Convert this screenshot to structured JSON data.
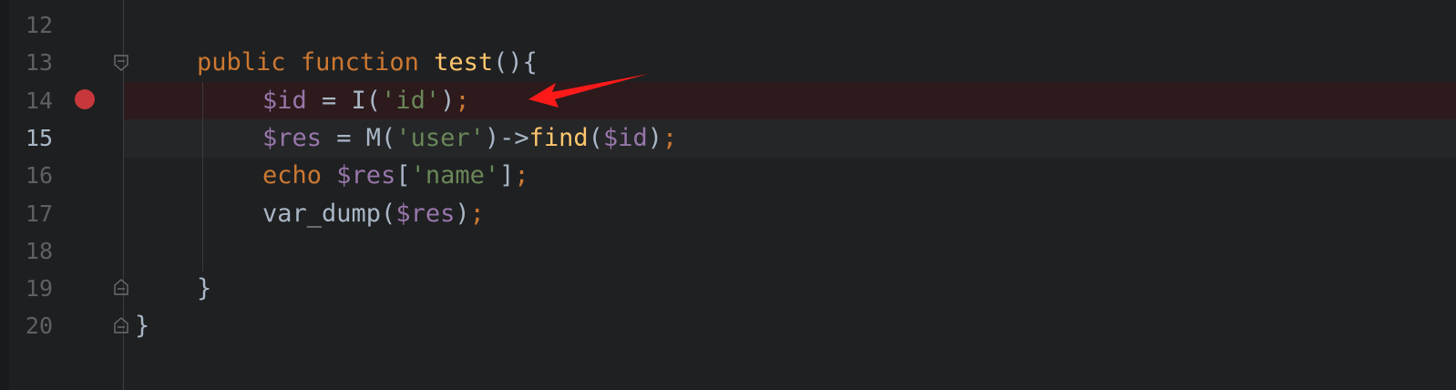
{
  "editor": {
    "lines": [
      {
        "number": "12",
        "tokens": []
      },
      {
        "number": "13",
        "tokens": [
          {
            "t": "kw",
            "v": "public"
          },
          {
            "t": "punc",
            "v": " "
          },
          {
            "t": "kw",
            "v": "function"
          },
          {
            "t": "punc",
            "v": " "
          },
          {
            "t": "fn",
            "v": "test"
          },
          {
            "t": "punc",
            "v": "(){"
          }
        ]
      },
      {
        "number": "14",
        "tokens": [
          {
            "t": "var",
            "v": "$id"
          },
          {
            "t": "punc",
            "v": " = I("
          },
          {
            "t": "str",
            "v": "'id'"
          },
          {
            "t": "punc",
            "v": ")"
          },
          {
            "t": "semi",
            "v": ";"
          }
        ]
      },
      {
        "number": "15",
        "tokens": [
          {
            "t": "var",
            "v": "$res"
          },
          {
            "t": "punc",
            "v": " = M("
          },
          {
            "t": "str",
            "v": "'user'"
          },
          {
            "t": "punc",
            "v": ")->"
          },
          {
            "t": "fn",
            "v": "find"
          },
          {
            "t": "punc",
            "v": "("
          },
          {
            "t": "var",
            "v": "$id"
          },
          {
            "t": "punc",
            "v": ")"
          },
          {
            "t": "semi",
            "v": ";"
          }
        ]
      },
      {
        "number": "16",
        "tokens": [
          {
            "t": "kw",
            "v": "echo"
          },
          {
            "t": "punc",
            "v": " "
          },
          {
            "t": "var",
            "v": "$res"
          },
          {
            "t": "punc",
            "v": "["
          },
          {
            "t": "str",
            "v": "'name'"
          },
          {
            "t": "punc",
            "v": "]"
          },
          {
            "t": "semi",
            "v": ";"
          }
        ]
      },
      {
        "number": "17",
        "tokens": [
          {
            "t": "punc",
            "v": "var_dump("
          },
          {
            "t": "var",
            "v": "$res"
          },
          {
            "t": "punc",
            "v": ")"
          },
          {
            "t": "semi",
            "v": ";"
          }
        ]
      },
      {
        "number": "18",
        "tokens": []
      },
      {
        "number": "19",
        "tokens": [
          {
            "t": "punc",
            "v": "}"
          }
        ]
      },
      {
        "number": "20",
        "tokens": [
          {
            "t": "punc",
            "v": "}"
          }
        ]
      }
    ],
    "breakpoint_line": "14",
    "current_line": "15"
  },
  "colors": {
    "keyword": "#cc7832",
    "function": "#ffc66d",
    "variable": "#9876aa",
    "string": "#6a8759",
    "text": "#a9b7c6",
    "breakpoint": "#c8373c",
    "annotation_arrow": "#ff1a1a"
  },
  "icons": [
    "breakpoint-icon",
    "fold-marker-icon",
    "arrow-annotation-icon"
  ]
}
